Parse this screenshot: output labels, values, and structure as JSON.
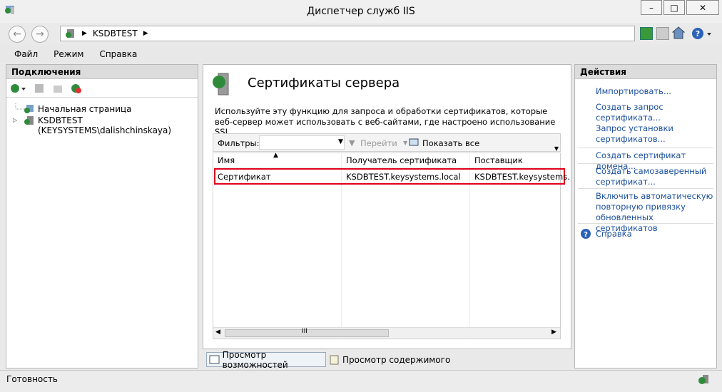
{
  "window": {
    "title": "Диспетчер служб IIS",
    "min": "–",
    "max": "□",
    "close": "✕"
  },
  "address": {
    "crumb": "KSDBTEST"
  },
  "menu": [
    "Файл",
    "Режим",
    "Справка"
  ],
  "connections": {
    "title": "Подключения",
    "start_page": "Начальная страница",
    "server": "KSDBTEST (KEYSYSTEMS\\dalishchinskaya)"
  },
  "main": {
    "title": "Сертификаты сервера",
    "desc1": "Используйте эту функцию для запроса и обработки сертификатов, которые",
    "desc2": "веб-сервер может использовать с веб-сайтами, где настроено использование SSL.",
    "filter_label": "Фильтры:",
    "go": "Перейти",
    "show_all": "Показать все",
    "columns": [
      "Имя",
      "Получатель сертификата",
      "Поставщик"
    ],
    "rows": [
      {
        "name": "Сертификат",
        "subject": "KSDBTEST.keysystems.local",
        "issuer": "KSDBTEST.keysystems."
      }
    ],
    "scroll_mark": "III"
  },
  "views": {
    "features": "Просмотр возможностей",
    "content": "Просмотр содержимого"
  },
  "actions": {
    "title": "Действия",
    "items": [
      [
        "Импортировать..."
      ],
      [
        "Создать запрос",
        "сертификата..."
      ],
      [
        "Запрос установки",
        "сертификатов..."
      ],
      [
        "Создать сертификат домена..."
      ],
      [
        "Создать самозаверенный",
        "сертификат..."
      ],
      [
        "Включить автоматическую",
        "повторную привязку",
        "обновленных сертификатов"
      ]
    ],
    "help": "Справка"
  },
  "status": "Готовность",
  "colors": {
    "link": "#1a4f9c",
    "highlight": "#e0001b",
    "panel_head": "#dcdcdc"
  }
}
